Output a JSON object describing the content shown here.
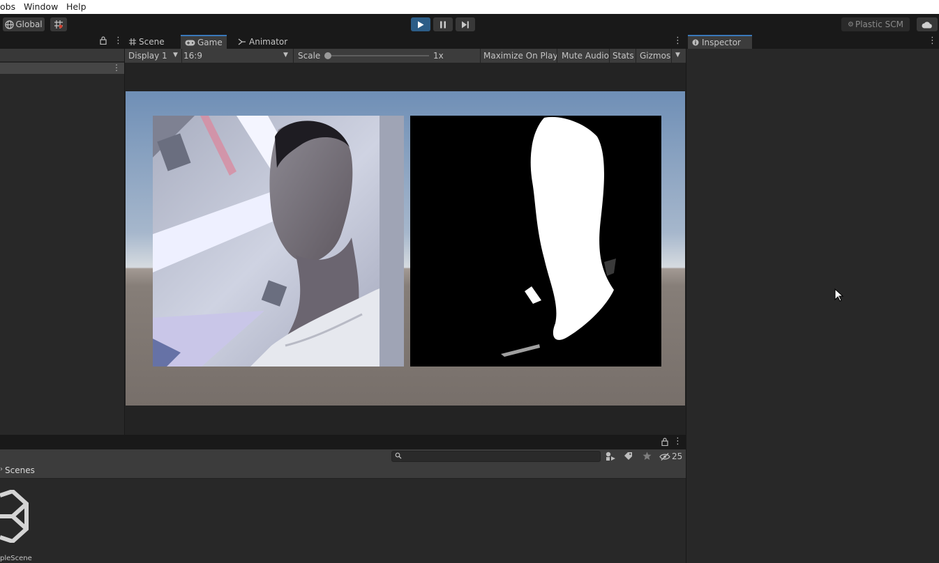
{
  "menu": {
    "items": [
      "obs",
      "Window",
      "Help"
    ]
  },
  "toolbar": {
    "global_label": "Global",
    "plastic_label": "Plastic SCM"
  },
  "game_tabs": [
    "Scene",
    "Game",
    "Animator"
  ],
  "game_controls": {
    "display": "Display 1",
    "aspect": "16:9",
    "scale_label": "Scale",
    "scale_value": "1x",
    "maximize": "Maximize On Play",
    "mute": "Mute Audio",
    "stats": "Stats",
    "gizmos": "Gizmos"
  },
  "inspector": {
    "tab": "Inspector"
  },
  "project": {
    "hidden_count": "25",
    "breadcrumb": "Scenes",
    "asset_name": "pleScene"
  },
  "colors": {
    "accent": "#3a79bb",
    "play_active": "#2c5d87",
    "panel": "#282828",
    "bar": "#3c3c3c"
  }
}
